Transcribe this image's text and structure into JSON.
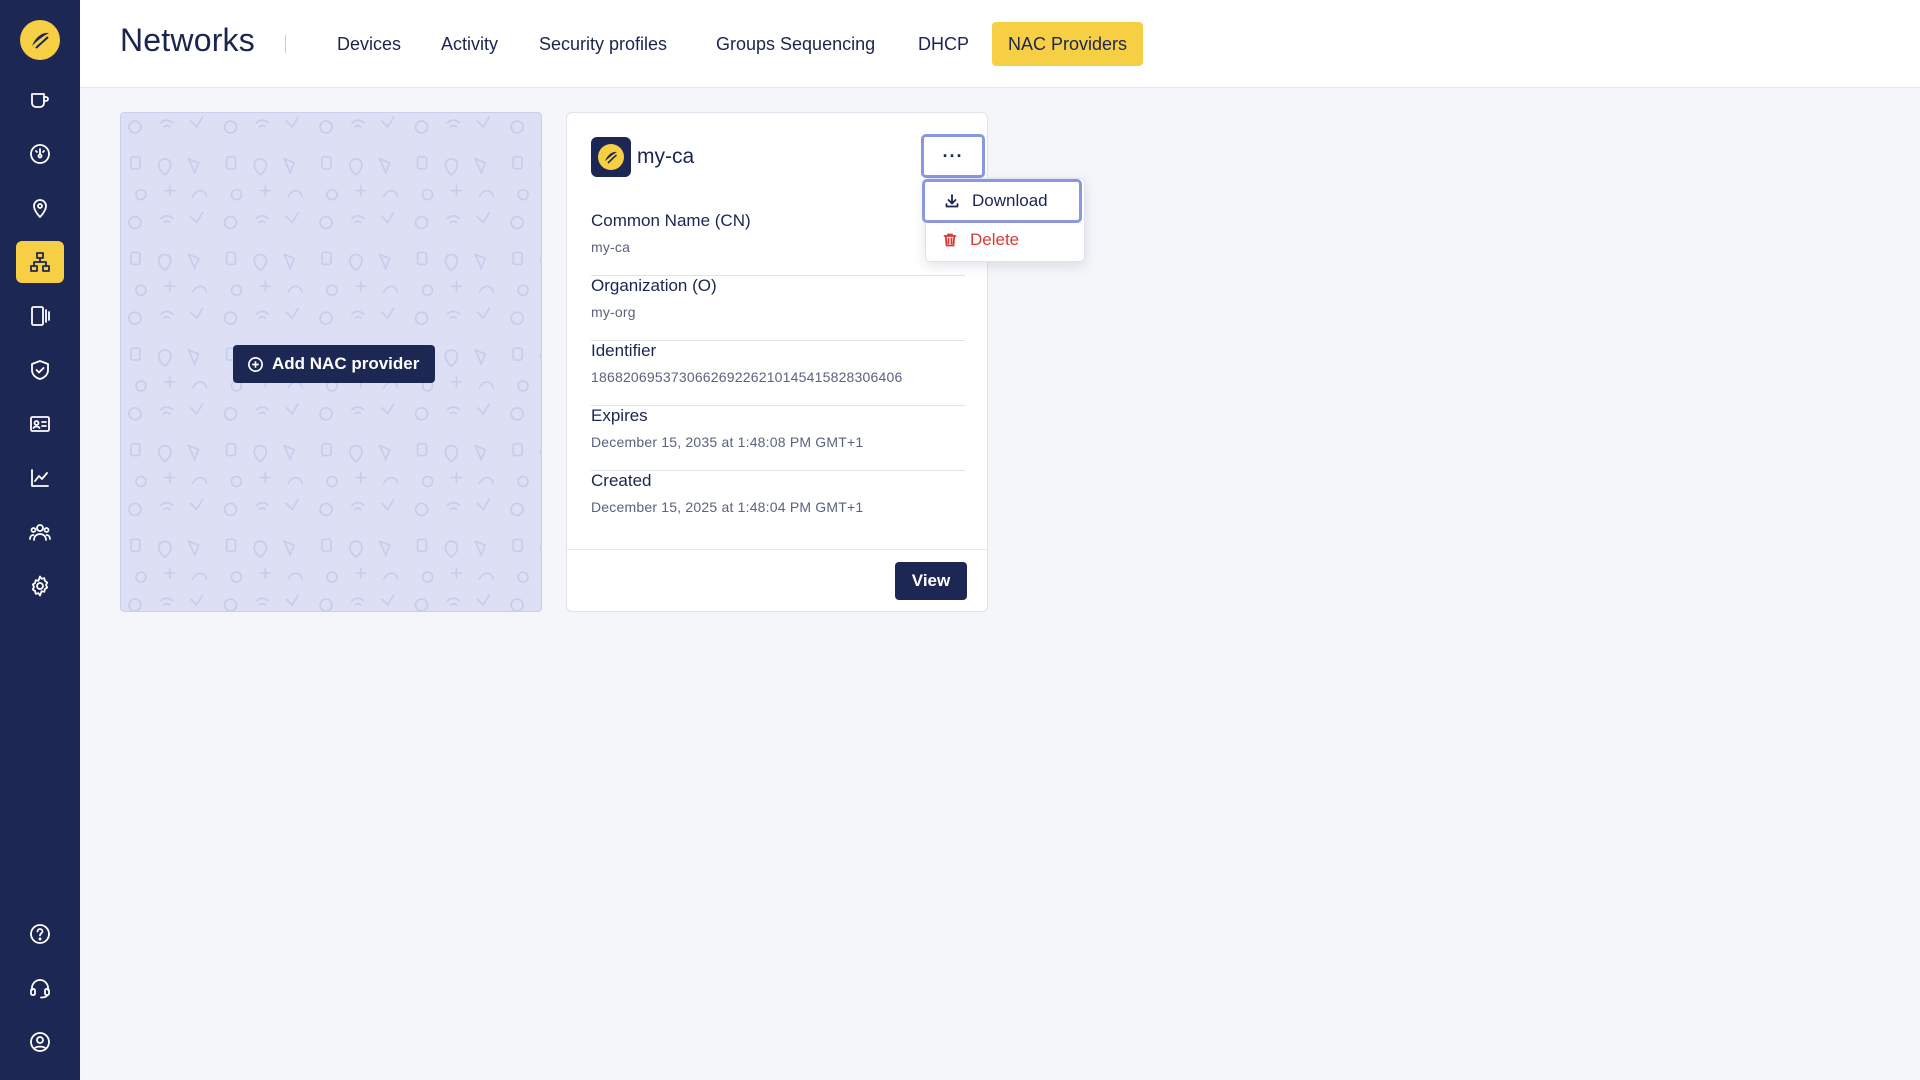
{
  "page": {
    "title": "Networks"
  },
  "tabs": [
    {
      "label": "Devices"
    },
    {
      "label": "Activity"
    },
    {
      "label": "Security profiles"
    },
    {
      "label": "Groups Sequencing"
    },
    {
      "label": "DHCP"
    },
    {
      "label": "NAC Providers",
      "active": true
    }
  ],
  "sidebar": {
    "top_items": [
      "logo-icon",
      "coffee-cup-icon",
      "dashboard-gauge-icon",
      "location-pin-icon",
      "network-icon",
      "devices-icon",
      "shield-check-icon",
      "id-card-icon",
      "line-chart-icon",
      "users-icon",
      "gear-icon"
    ],
    "bottom_items": [
      "help-icon",
      "headset-icon",
      "account-icon"
    ],
    "active": "network-icon"
  },
  "add_card": {
    "button_label": "Add NAC provider"
  },
  "provider": {
    "name": "my-ca",
    "more_label": "···",
    "fields": [
      {
        "label": "Common Name (CN)",
        "value": "my-ca"
      },
      {
        "label": "Organization (O)",
        "value": "my-org"
      },
      {
        "label": "Identifier",
        "value": "186820695373066269226210145415828306406"
      },
      {
        "label": "Expires",
        "value": "December 15, 2035 at 1:48:08 PM GMT+1"
      },
      {
        "label": "Created",
        "value": "December 15, 2025 at 1:48:04 PM GMT+1"
      }
    ],
    "view_label": "View"
  },
  "menu": {
    "download_label": "Download",
    "delete_label": "Delete"
  },
  "colors": {
    "sidebar": "#1c2754",
    "accent": "#f7cf45",
    "danger": "#d93a33",
    "focus_ring": "#8b98e0"
  }
}
